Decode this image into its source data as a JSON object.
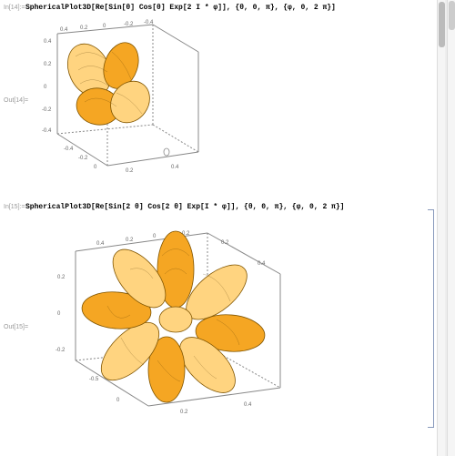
{
  "cells": [
    {
      "in_label": "In[14]:=",
      "out_label": "Out[14]=",
      "input": "SphericalPlot3D[Re[Sin[θ] Cos[θ] Exp[2 I * φ]], {θ, 0, π}, {φ, 0, 2 π}]"
    },
    {
      "in_label": "In[15]:=",
      "out_label": "Out[15]=",
      "input": "SphericalPlot3D[Re[Sin[2 θ] Cos[2 θ] Exp[I * φ]], {θ, 0, π}, {φ, 0, 2 π}]"
    }
  ],
  "plot1": {
    "axis_ticks": [
      "0.4",
      "0.2",
      "0",
      "-0.2",
      "-0.4"
    ]
  },
  "plot2": {
    "axis_ticks": [
      "0.4",
      "0.2",
      "0",
      "-0.2",
      "-0.5"
    ]
  }
}
